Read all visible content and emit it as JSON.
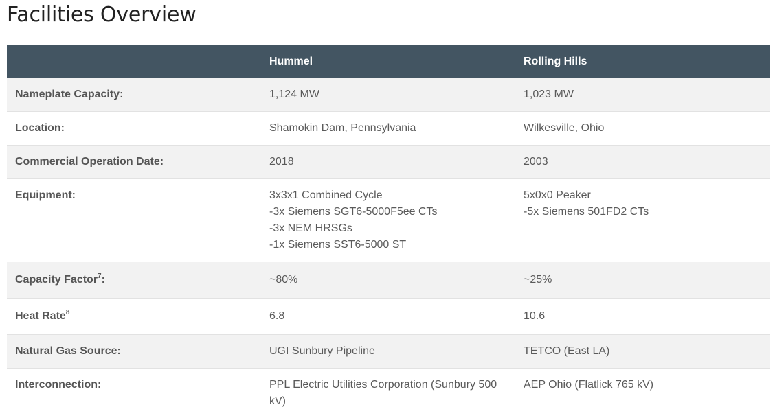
{
  "page": {
    "title": "Facilities Overview"
  },
  "table": {
    "headers": [
      "",
      "Hummel",
      "Rolling Hills"
    ],
    "rows": [
      {
        "label": "Nameplate Capacity:",
        "hummel": [
          "1,124 MW"
        ],
        "rolling_hills": [
          "1,023 MW"
        ]
      },
      {
        "label": "Location:",
        "hummel": [
          "Shamokin Dam, Pennsylvania"
        ],
        "rolling_hills": [
          "Wilkesville, Ohio"
        ]
      },
      {
        "label": "Commercial Operation Date:",
        "hummel": [
          "2018"
        ],
        "rolling_hills": [
          "2003"
        ]
      },
      {
        "label": "Equipment:",
        "hummel": [
          "3x3x1 Combined Cycle",
          "-3x Siemens SGT6-5000F5ee CTs",
          "-3x NEM HRSGs",
          "-1x Siemens SST6-5000 ST"
        ],
        "rolling_hills": [
          "5x0x0 Peaker",
          "-5x Siemens 501FD2 CTs"
        ]
      },
      {
        "label": "Capacity Factor",
        "label_sup": "7",
        "label_suffix": ":",
        "hummel": [
          "~80%"
        ],
        "rolling_hills": [
          "~25%"
        ]
      },
      {
        "label": "Heat Rate",
        "label_sup": "8",
        "label_suffix": "",
        "hummel": [
          "6.8"
        ],
        "rolling_hills": [
          "10.6"
        ]
      },
      {
        "label": "Natural Gas Source:",
        "hummel": [
          "UGI Sunbury Pipeline"
        ],
        "rolling_hills": [
          "TETCO (East LA)"
        ]
      },
      {
        "label": "Interconnection:",
        "hummel": [
          "PPL Electric Utilities Corporation (Sunbury 500 kV)"
        ],
        "rolling_hills": [
          "AEP Ohio (Flatlick 765 kV)"
        ]
      }
    ]
  }
}
